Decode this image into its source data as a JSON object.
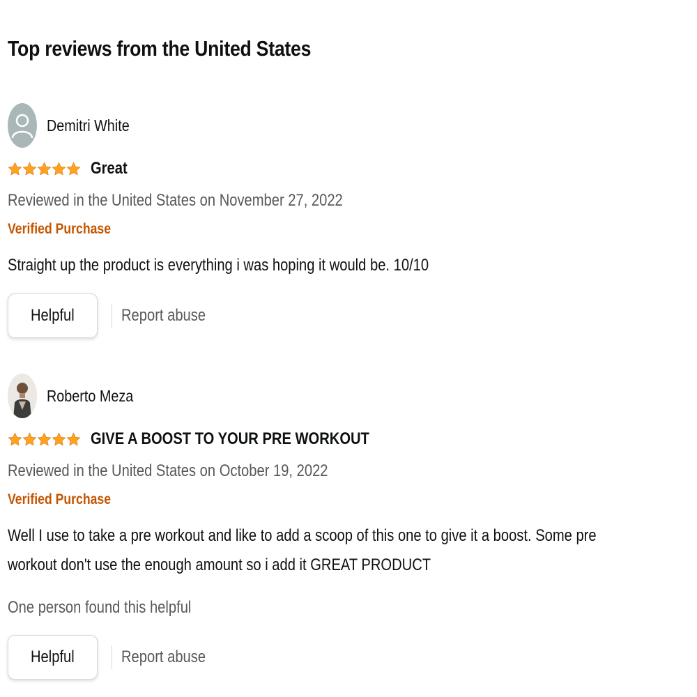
{
  "section_title": "Top reviews from the United States",
  "colors": {
    "star": "#ffa41c",
    "verified": "#c45500",
    "muted_text": "#565959",
    "text": "#0f1111"
  },
  "reviews": [
    {
      "reviewer_name": "Demitri White",
      "avatar": "default-avatar-icon",
      "rating": 5,
      "rating_max": 5,
      "title": "Great",
      "date": "Reviewed in the United States on November 27, 2022",
      "verified_label": "Verified Purchase",
      "body": "Straight up the product is everything i was hoping it would be. 10/10",
      "helpful_count_text": "",
      "helpful_label": "Helpful",
      "report_label": "Report abuse"
    },
    {
      "reviewer_name": "Roberto Meza",
      "avatar": "user-photo-avatar",
      "rating": 5,
      "rating_max": 5,
      "title": "GIVE A BOOST TO YOUR PRE WORKOUT",
      "date": "Reviewed in the United States on October 19, 2022",
      "verified_label": "Verified Purchase",
      "body": "Well I use to take a pre workout and like to add a scoop of this one to give it a boost. Some pre workout don't use the enough amount so i add it GREAT PRODUCT",
      "helpful_count_text": "One person found this helpful",
      "helpful_label": "Helpful",
      "report_label": "Report abuse"
    }
  ]
}
